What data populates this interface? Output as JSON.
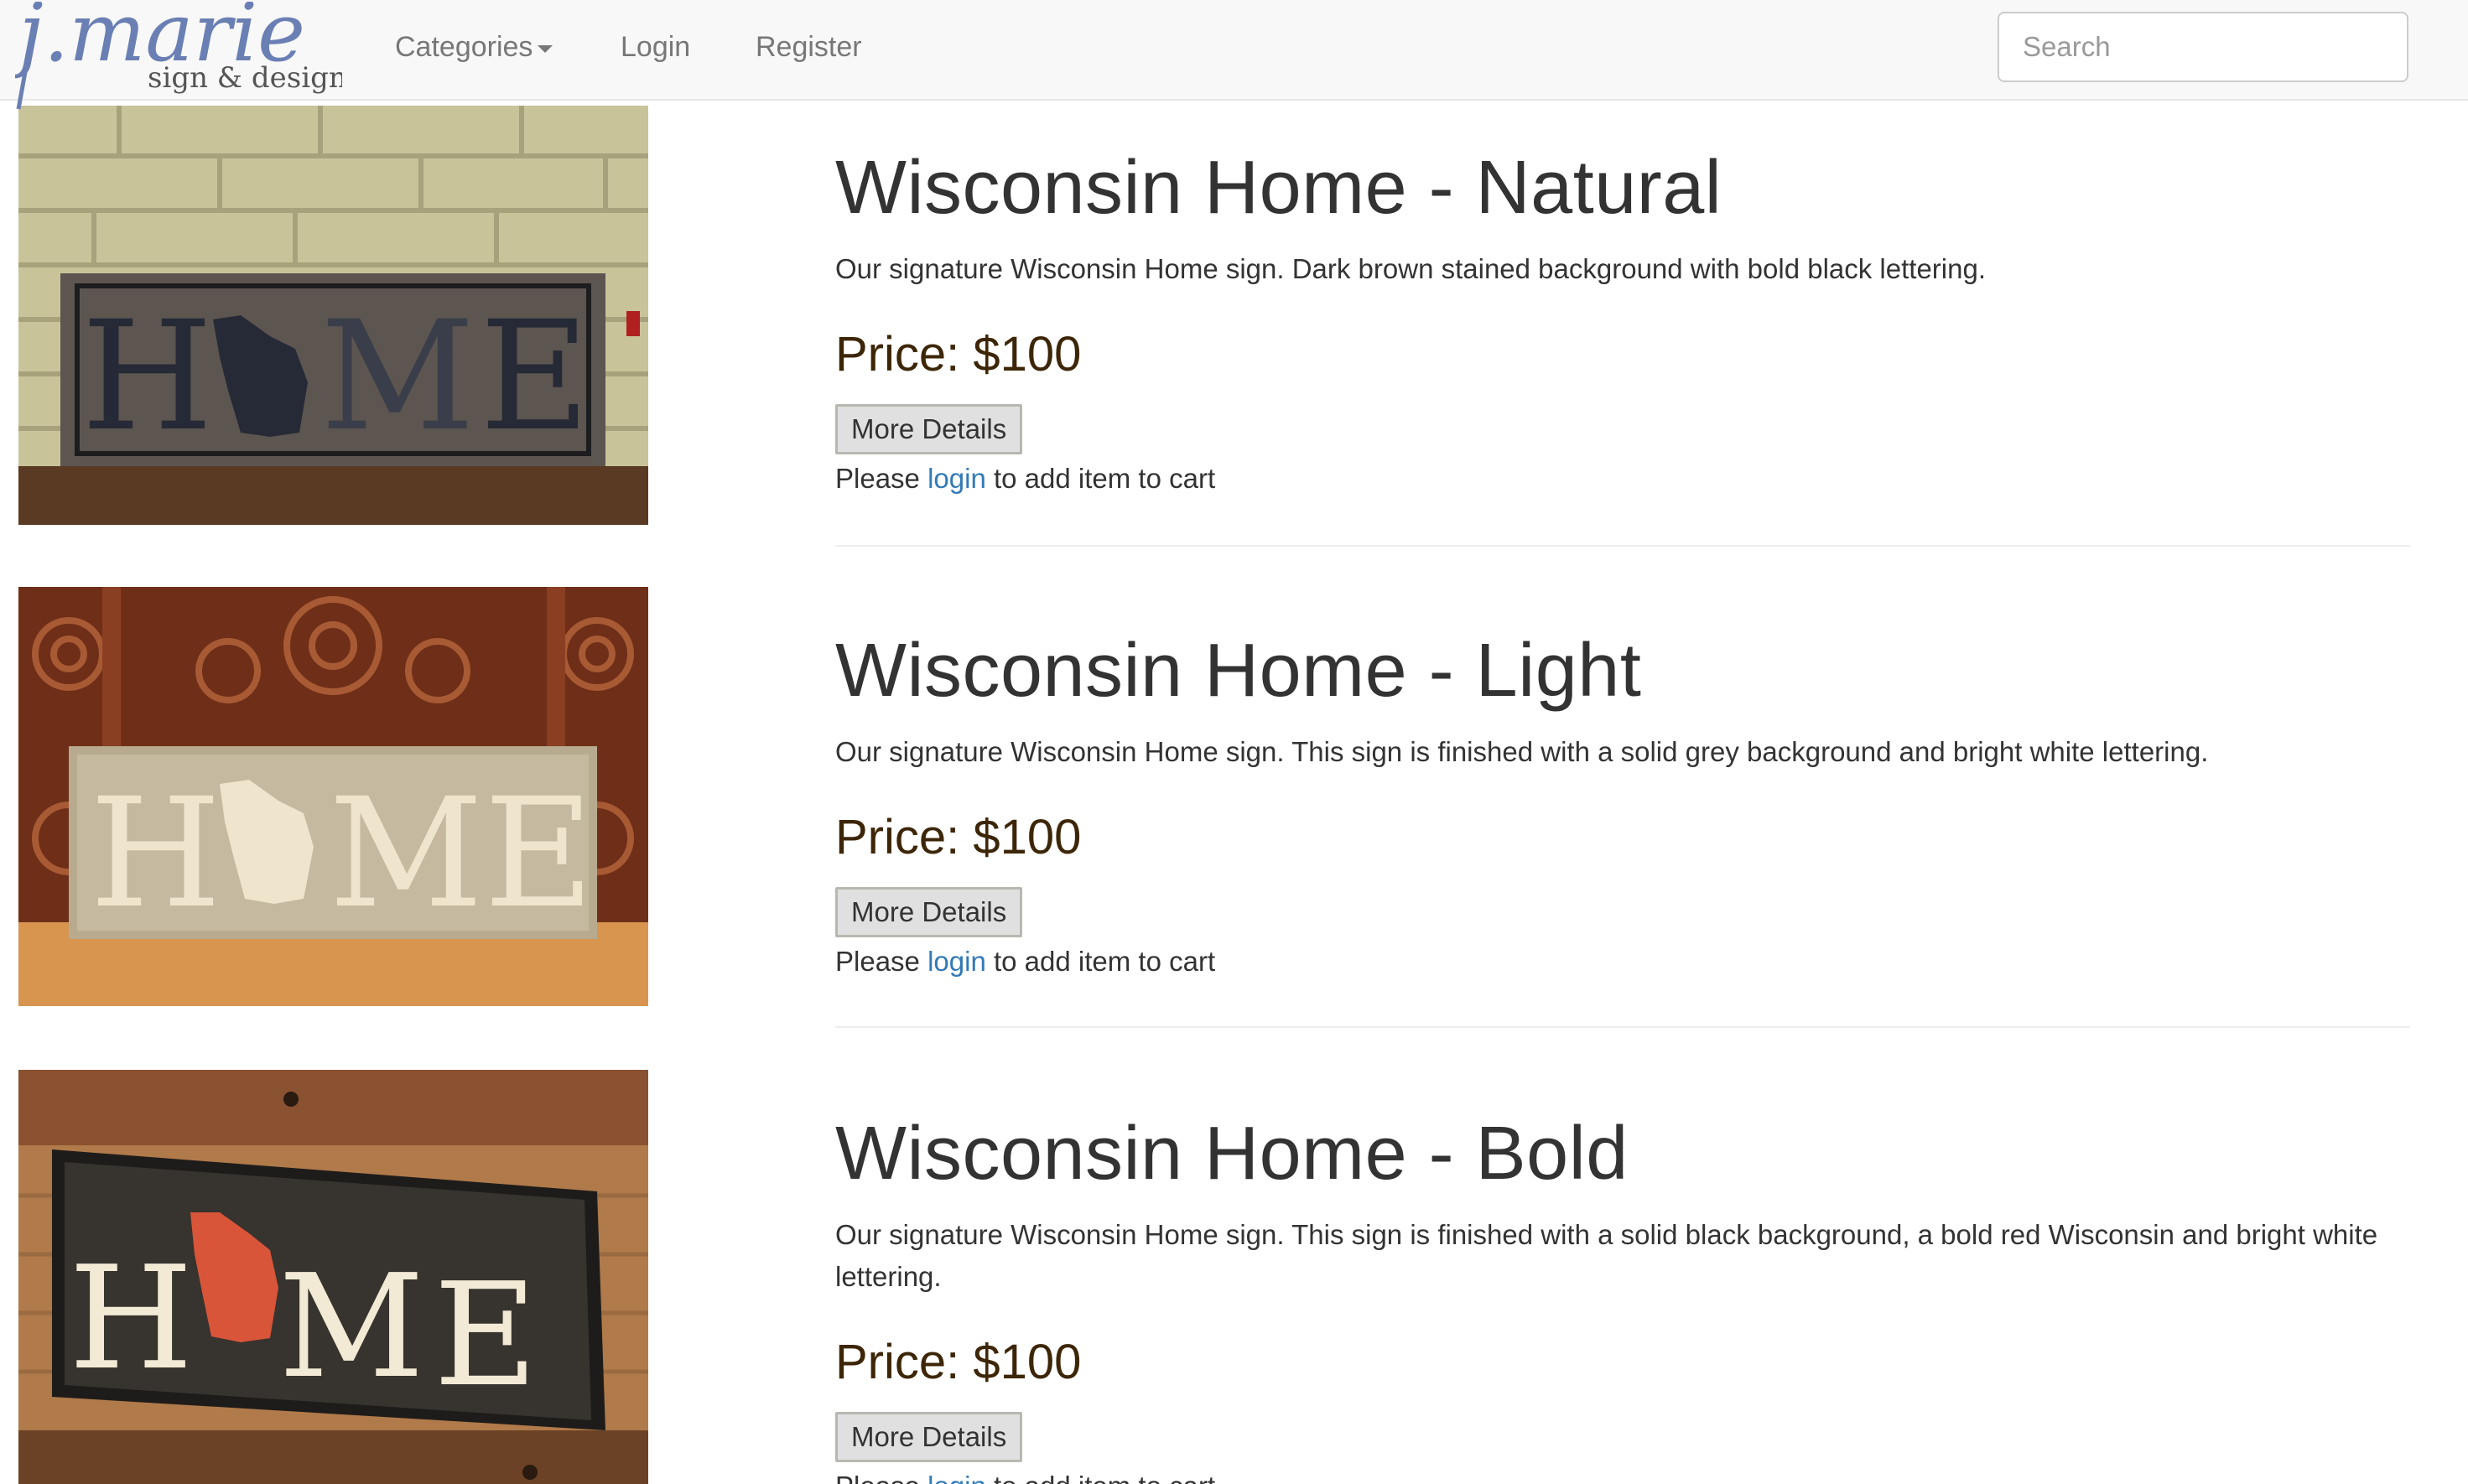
{
  "brand": {
    "logo_text": "j.marie",
    "logo_sub": "sign & design"
  },
  "nav": {
    "categories": "Categories",
    "login": "Login",
    "register": "Register"
  },
  "search": {
    "placeholder": "Search"
  },
  "products": [
    {
      "title": "Wisconsin Home - Natural",
      "description": "Our signature Wisconsin Home sign. Dark brown stained background with bold black lettering.",
      "price": "Price: $100",
      "details_label": "More Details",
      "login_prefix": "Please",
      "login_link": "login",
      "login_suffix": "to add item to cart",
      "sign_text": [
        "H",
        "M",
        "E"
      ]
    },
    {
      "title": "Wisconsin Home - Light",
      "description": "Our signature Wisconsin Home sign. This sign is finished with a solid grey background and bright white lettering.",
      "price": "Price: $100",
      "details_label": "More Details",
      "login_prefix": "Please",
      "login_link": "login",
      "login_suffix": "to add item to cart",
      "sign_text": [
        "H",
        "M",
        "E"
      ]
    },
    {
      "title": "Wisconsin Home - Bold",
      "description": "Our signature Wisconsin Home sign. This sign is finished with a solid black background, a bold red Wisconsin and bright white lettering.",
      "price": "Price: $100",
      "details_label": "More Details",
      "login_prefix": "Please",
      "login_link": "login",
      "login_suffix": "to add item to cart",
      "sign_text": [
        "H",
        "M",
        "E"
      ]
    }
  ],
  "colors": {
    "link": "#337ab7",
    "price": "#3d2608",
    "navbar_bg": "#f8f8f8",
    "logo_script": "#6a7fb3",
    "logo_sub": "#555555"
  }
}
